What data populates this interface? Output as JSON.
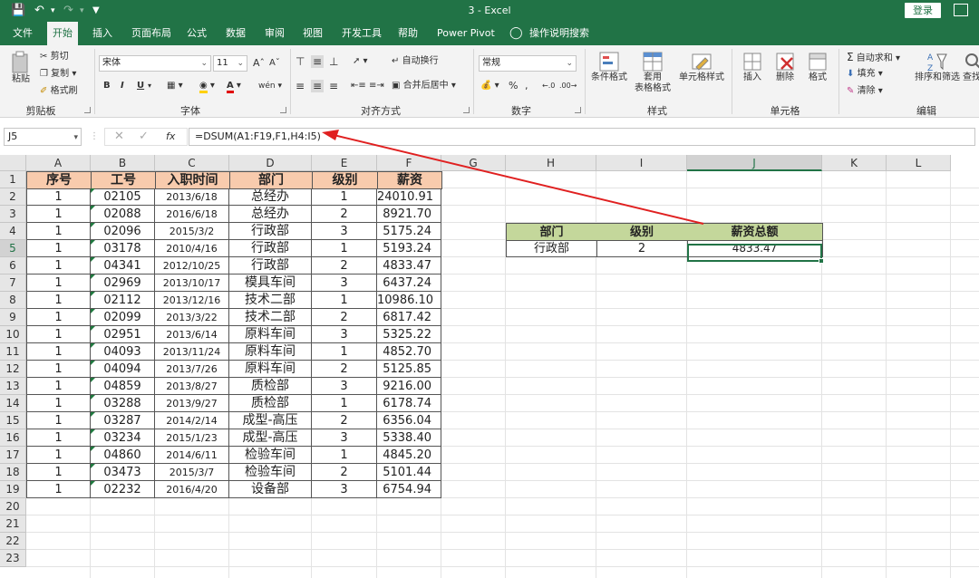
{
  "titlebar": {
    "title": "3 - Excel",
    "login_label": "登录"
  },
  "tabs": [
    {
      "label": "文件"
    },
    {
      "label": "开始"
    },
    {
      "label": "插入"
    },
    {
      "label": "页面布局"
    },
    {
      "label": "公式"
    },
    {
      "label": "数据"
    },
    {
      "label": "审阅"
    },
    {
      "label": "视图"
    },
    {
      "label": "开发工具"
    },
    {
      "label": "帮助"
    },
    {
      "label": "Power Pivot"
    },
    {
      "label": "操作说明搜索"
    }
  ],
  "active_tab": "开始",
  "ribbon": {
    "clipboard": {
      "paste": "粘贴",
      "cut": "剪切",
      "copy": "复制",
      "format_painter": "格式刷",
      "label": "剪贴板"
    },
    "font": {
      "name": "宋体",
      "size": "11",
      "bold": "B",
      "italic": "I",
      "underline": "U",
      "label": "字体"
    },
    "align": {
      "wrap": "自动换行",
      "merge": "合并后居中",
      "label": "对齐方式"
    },
    "number": {
      "format": "常规",
      "label": "数字"
    },
    "styles": {
      "conditional": "条件格式",
      "table_line1": "套用",
      "table_line2": "表格格式",
      "cell_styles": "单元格样式",
      "label": "样式"
    },
    "cells": {
      "insert": "插入",
      "delete": "删除",
      "format": "格式",
      "label": "单元格"
    },
    "editing": {
      "autosum": "自动求和",
      "fill": "填充",
      "clear": "清除",
      "sort": "排序和筛选",
      "find": "查找",
      "label": "编辑"
    }
  },
  "formula_bar": {
    "name_box": "J5",
    "fx": "fx",
    "formula": "=DSUM(A1:F19,F1,H4:I5)"
  },
  "columns": [
    "A",
    "B",
    "C",
    "D",
    "E",
    "F",
    "G",
    "H",
    "I",
    "J",
    "K",
    "L"
  ],
  "selected_column": "J",
  "rows": [
    "1",
    "2",
    "3",
    "4",
    "5",
    "6",
    "7",
    "8",
    "9",
    "10",
    "11",
    "12",
    "13",
    "14",
    "15",
    "16",
    "17",
    "18",
    "19",
    "20",
    "21",
    "22",
    "23"
  ],
  "selected_row": "5",
  "table": {
    "headers": [
      "序号",
      "工号",
      "入职时间",
      "部门",
      "级别",
      "薪资"
    ],
    "rows": [
      [
        "1",
        "02105",
        "2013/6/18",
        "总经办",
        "1",
        "24010.91"
      ],
      [
        "1",
        "02088",
        "2016/6/18",
        "总经办",
        "2",
        "8921.70"
      ],
      [
        "1",
        "02096",
        "2015/3/2",
        "行政部",
        "3",
        "5175.24"
      ],
      [
        "1",
        "03178",
        "2010/4/16",
        "行政部",
        "1",
        "5193.24"
      ],
      [
        "1",
        "04341",
        "2012/10/25",
        "行政部",
        "2",
        "4833.47"
      ],
      [
        "1",
        "02969",
        "2013/10/17",
        "模具车间",
        "3",
        "6437.24"
      ],
      [
        "1",
        "02112",
        "2013/12/16",
        "技术二部",
        "1",
        "10986.10"
      ],
      [
        "1",
        "02099",
        "2013/3/22",
        "技术二部",
        "2",
        "6817.42"
      ],
      [
        "1",
        "02951",
        "2013/6/14",
        "原料车间",
        "3",
        "5325.22"
      ],
      [
        "1",
        "04093",
        "2013/11/24",
        "原料车间",
        "1",
        "4852.70"
      ],
      [
        "1",
        "04094",
        "2013/7/26",
        "原料车间",
        "2",
        "5125.85"
      ],
      [
        "1",
        "04859",
        "2013/8/27",
        "质检部",
        "3",
        "9216.00"
      ],
      [
        "1",
        "03288",
        "2013/9/27",
        "质检部",
        "1",
        "6178.74"
      ],
      [
        "1",
        "03287",
        "2014/2/14",
        "成型-高压",
        "2",
        "6356.04"
      ],
      [
        "1",
        "03234",
        "2015/1/23",
        "成型-高压",
        "3",
        "5338.40"
      ],
      [
        "1",
        "04860",
        "2014/6/11",
        "检验车间",
        "1",
        "4845.20"
      ],
      [
        "1",
        "03473",
        "2015/3/7",
        "检验车间",
        "2",
        "5101.44"
      ],
      [
        "1",
        "02232",
        "2016/4/20",
        "设备部",
        "3",
        "6754.94"
      ]
    ]
  },
  "criteria": {
    "headers": [
      "部门",
      "级别",
      "薪资总额"
    ],
    "values": [
      "行政部",
      "2",
      "4833.47"
    ]
  },
  "colors": {
    "excel_green": "#217346",
    "header_fill": "#f8cbad",
    "criteria_fill": "#c4d79b",
    "arrow": "#e02020"
  }
}
